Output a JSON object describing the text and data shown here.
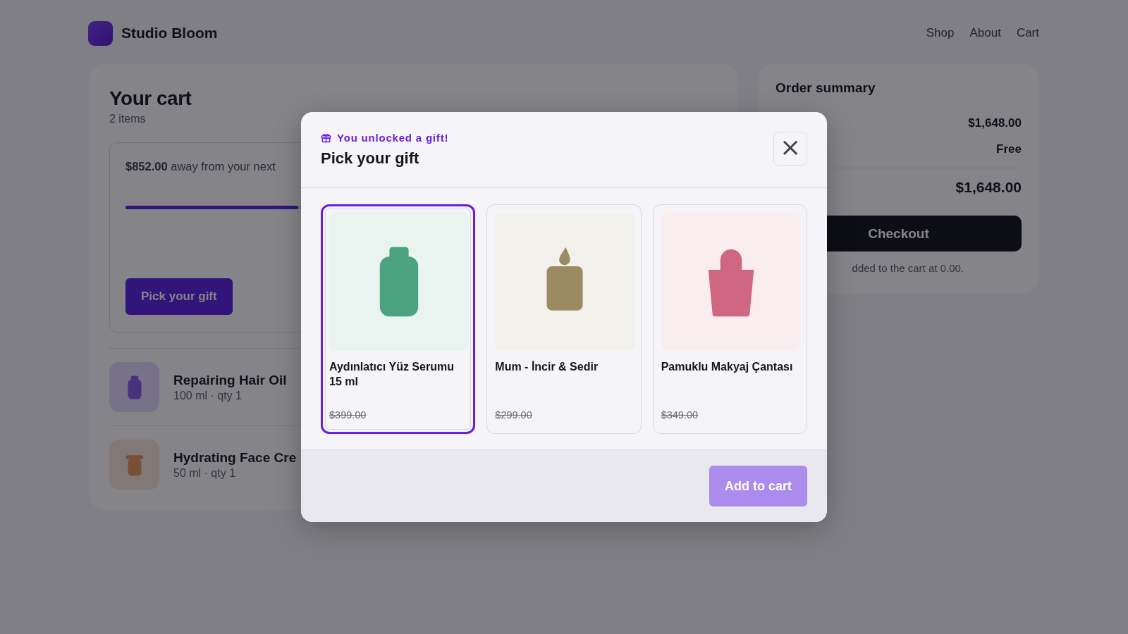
{
  "brand": {
    "name": "Studio Bloom"
  },
  "nav": [
    {
      "label": "Shop"
    },
    {
      "label": "About"
    },
    {
      "label": "Cart"
    }
  ],
  "cart": {
    "title": "Your cart",
    "count": "2 items",
    "progress": {
      "message": "**$852.00** away from your next",
      "level": 0.3,
      "button": "Pick your gift"
    },
    "items": [
      {
        "name": "Repairing Hair Oil",
        "detail": "100 ml · qty 1",
        "kind": "bottle"
      },
      {
        "name": "Hydrating Face Cre",
        "detail": "50 ml · qty 1",
        "kind": "jar"
      }
    ]
  },
  "summary": {
    "title": "Order summary",
    "rows": [
      {
        "value": "$1,648.00"
      },
      {
        "value": "Free"
      }
    ],
    "total": "$1,648.00",
    "checkout": "Checkout",
    "note": "dded to the cart at 0.00."
  },
  "modal": {
    "eyebrow": "You unlocked a gift!",
    "title": "Pick your gift",
    "close": "×",
    "button": "Add to cart",
    "gifts": [
      {
        "name": "Aydınlatıcı Yüz Serumu 15 ml",
        "price": "$399.00",
        "kind": "bottle",
        "color": "#4ba380",
        "selected": true
      },
      {
        "name": "Mum - İncir & Sedir",
        "price": "$299.00",
        "kind": "candle",
        "color": "#9c8a62",
        "selected": false
      },
      {
        "name": "Pamuklu Makyaj Çantası",
        "price": "$349.00",
        "kind": "bag",
        "color": "#cf6783",
        "selected": false
      }
    ]
  }
}
